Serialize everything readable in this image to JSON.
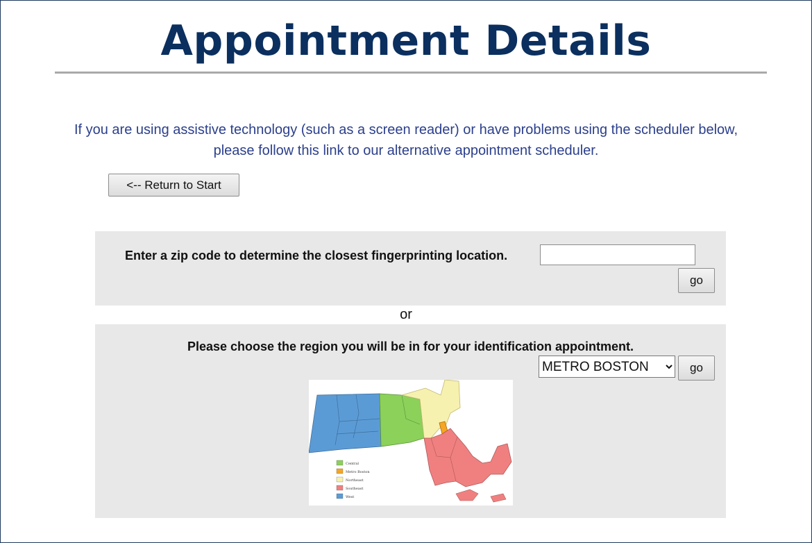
{
  "page": {
    "title": "Appointment Details",
    "assist_line1": "If you are using assistive technology (such as a screen reader) or have problems using the scheduler below,",
    "assist_line2": "please follow this link to our alternative appointment scheduler."
  },
  "return_button": {
    "label": "<-- Return to Start"
  },
  "zip_section": {
    "label": "Enter a zip code to determine the closest fingerprinting location.",
    "input_value": "",
    "go_label": "go"
  },
  "separator": "or",
  "region_section": {
    "label": "Please choose the region you will be in for your identification appointment.",
    "selected": "METRO BOSTON",
    "go_label": "go"
  },
  "map": {
    "legend": [
      {
        "name": "Central",
        "color": "#8cd15a"
      },
      {
        "name": "Metro Boston",
        "color": "#f5a623"
      },
      {
        "name": "Northeast",
        "color": "#f7f1b0"
      },
      {
        "name": "Southeast",
        "color": "#f08080"
      },
      {
        "name": "West",
        "color": "#5b9bd5"
      }
    ]
  }
}
